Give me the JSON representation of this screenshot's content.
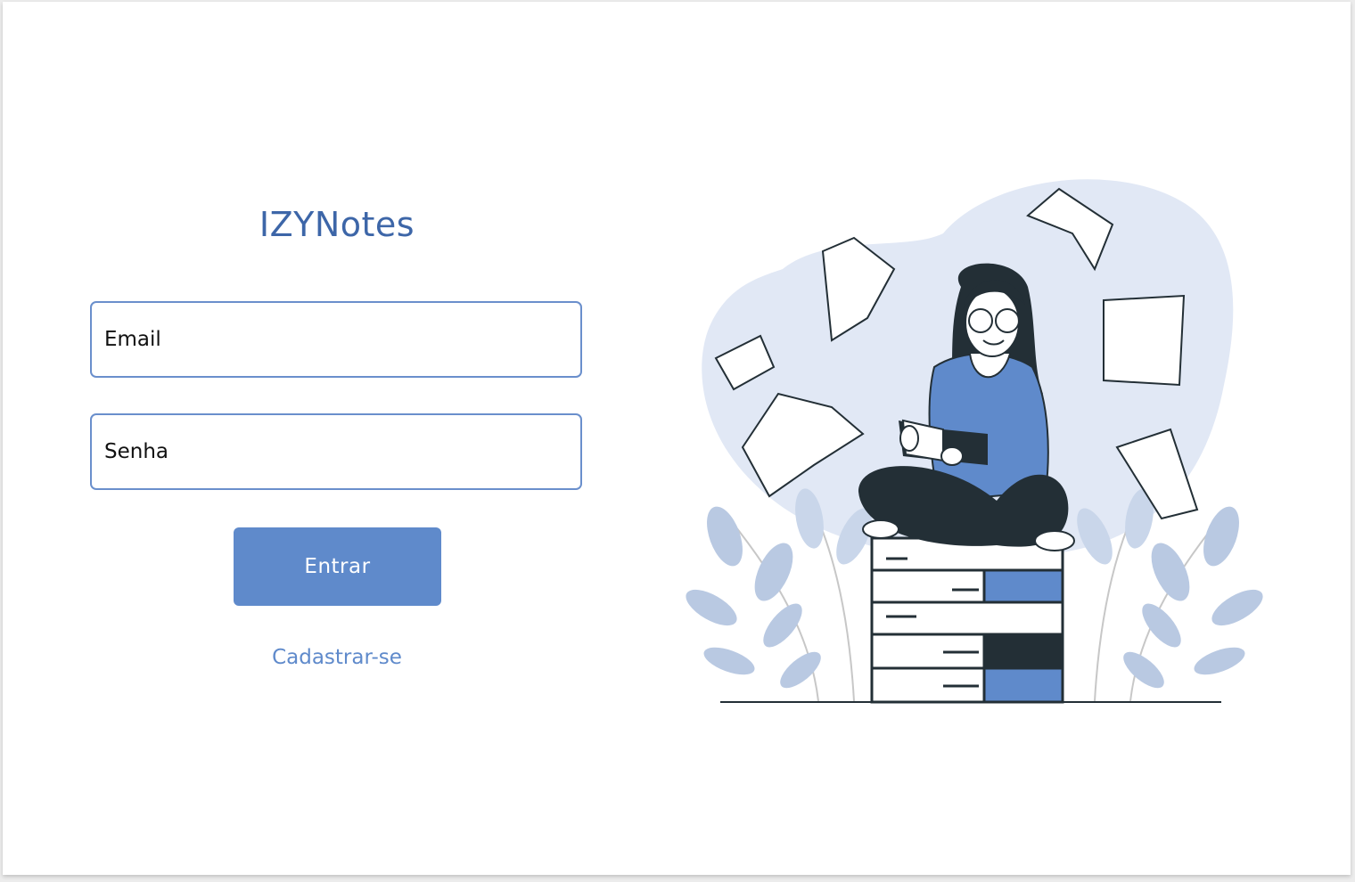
{
  "app": {
    "title": "IZYNotes"
  },
  "login_form": {
    "email_placeholder": "Email",
    "email_value": "",
    "password_placeholder": "Senha",
    "password_value": "",
    "submit_label": "Entrar",
    "signup_link": "Cadastrar-se"
  },
  "illustration": {
    "subject": "woman-reading-on-book-stack",
    "colors": {
      "blob": "#e1e8f5",
      "accent": "#5f8acb",
      "dark": "#232f36",
      "leaves": "#b9c9e2"
    }
  }
}
